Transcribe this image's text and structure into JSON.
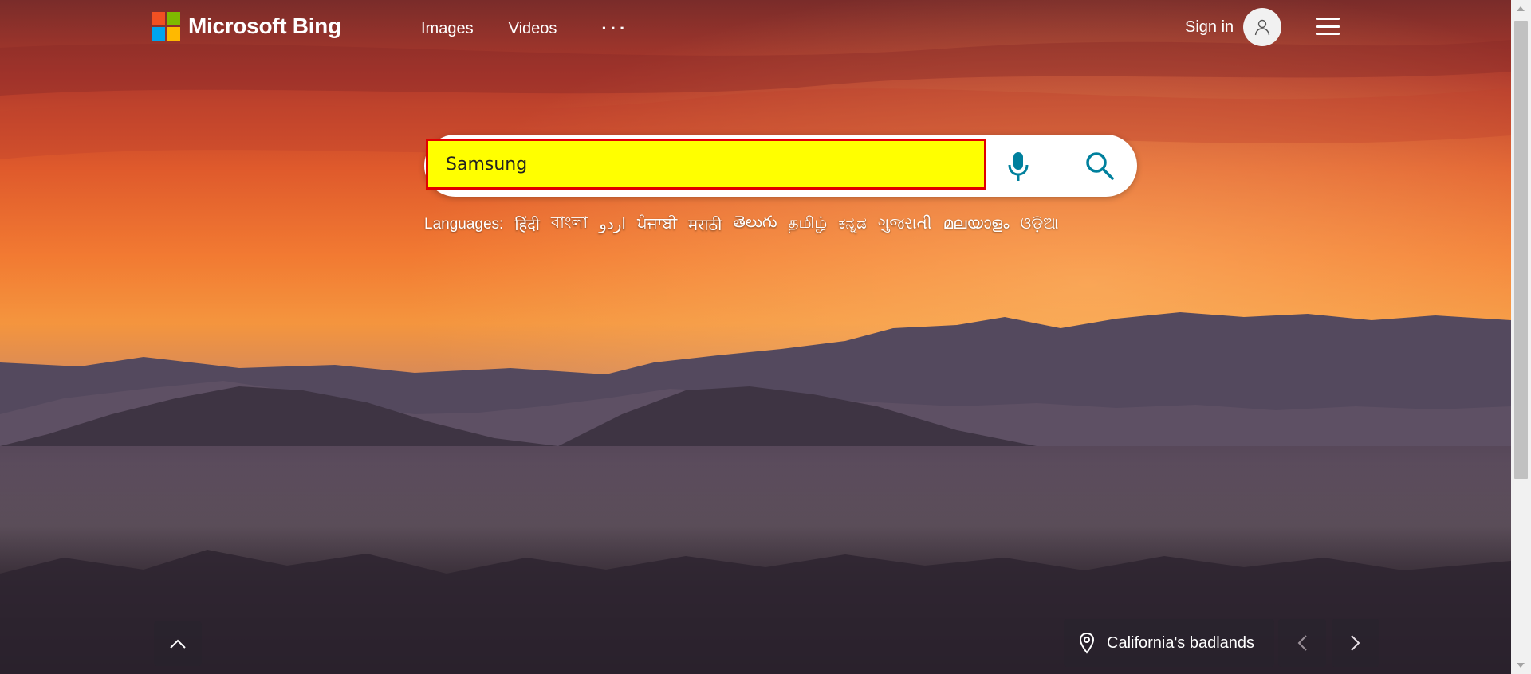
{
  "brand": {
    "name": "Microsoft Bing",
    "colors": {
      "red": "#f25022",
      "green": "#7fba00",
      "blue": "#00a4ef",
      "yellow": "#ffb900"
    }
  },
  "nav": {
    "items": [
      {
        "label": "Images"
      },
      {
        "label": "Videos"
      }
    ],
    "more_label": "···"
  },
  "header": {
    "signin_label": "Sign in",
    "avatar_icon": "user-icon",
    "menu_icon": "hamburger-icon"
  },
  "search": {
    "value": "Samsung",
    "mic_icon": "microphone-icon",
    "search_icon": "search-icon",
    "accent": "#00809d"
  },
  "languages": {
    "label": "Languages:",
    "items": [
      "हिंदी",
      "বাংলা",
      "اردو",
      "ਪੰਜਾਬੀ",
      "मराठी",
      "తెలుగు",
      "தமிழ்",
      "ಕನ್ನಡ",
      "ગુજરાતી",
      "മലയാളം",
      "ଓଡ଼ିଆ"
    ]
  },
  "image_info": {
    "caption": "California's badlands",
    "location_icon": "location-pin-icon"
  },
  "controls": {
    "up_icon": "chevron-up-icon",
    "prev_icon": "chevron-left-icon",
    "next_icon": "chevron-right-icon"
  }
}
